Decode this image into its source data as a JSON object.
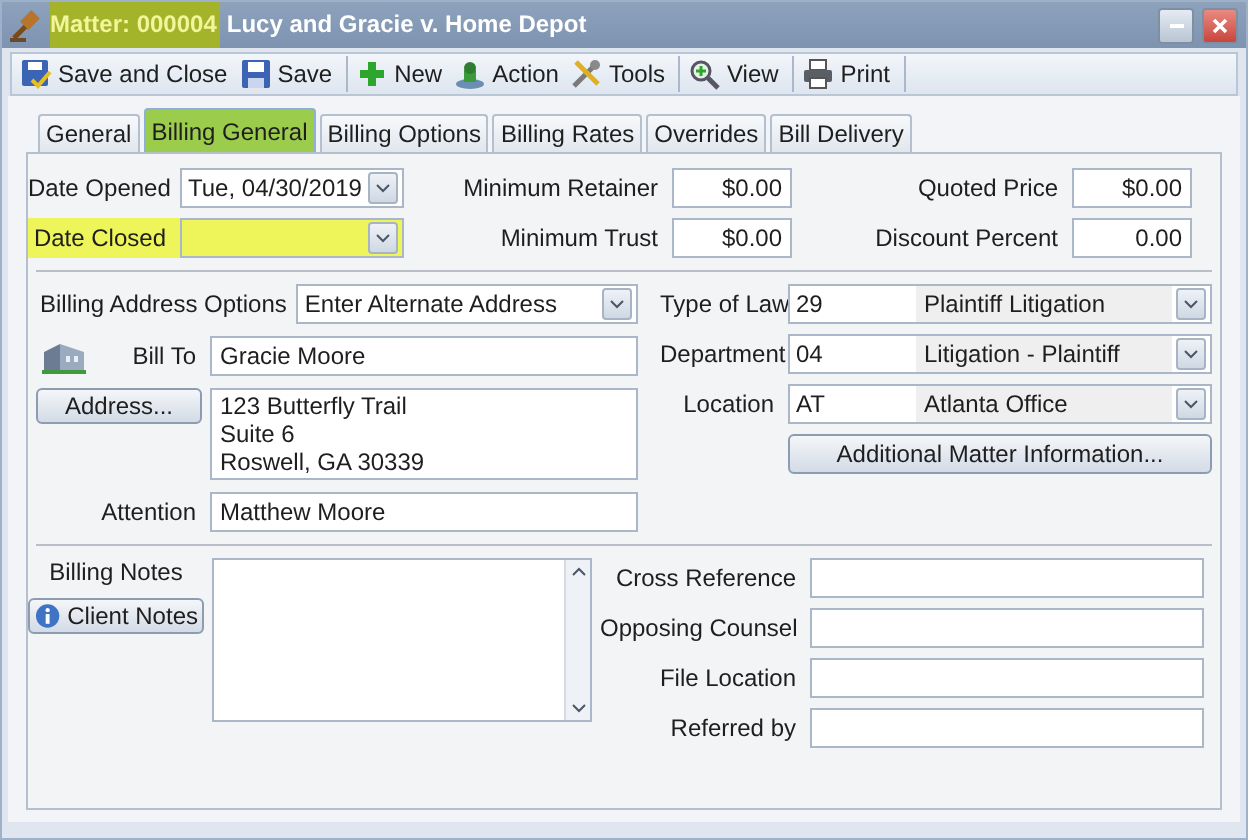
{
  "window": {
    "title_prefix": "Matter: 000004",
    "title_highlighted": true,
    "title": "Lucy and Gracie v. Home Depot"
  },
  "toolbar": [
    [
      {
        "kind": "save-close",
        "label": "Save and Close"
      },
      {
        "kind": "save",
        "label": "Save"
      }
    ],
    [
      {
        "kind": "new",
        "label": "New"
      },
      {
        "kind": "action",
        "label": "Action"
      },
      {
        "kind": "tools",
        "label": "Tools"
      }
    ],
    [
      {
        "kind": "view",
        "label": "View"
      }
    ],
    [
      {
        "kind": "print",
        "label": "Print"
      }
    ]
  ],
  "tabs": [
    {
      "label": "General",
      "selected": false,
      "highlighted": false
    },
    {
      "label": "Billing General",
      "selected": true,
      "highlighted": true
    },
    {
      "label": "Billing Options",
      "selected": false,
      "highlighted": false
    },
    {
      "label": "Billing Rates",
      "selected": false,
      "highlighted": false
    },
    {
      "label": "Overrides",
      "selected": false,
      "highlighted": false
    },
    {
      "label": "Bill Delivery",
      "selected": false,
      "highlighted": false
    }
  ],
  "dates": [
    {
      "label": "Date Opened",
      "value": "Tue, 04/30/2019",
      "highlighted": false
    },
    {
      "label": "Date Closed",
      "highlighted": true
    }
  ],
  "amounts": [
    {
      "label": "Minimum Retainer",
      "value": "$0.00"
    },
    {
      "label": "Quoted Price",
      "value": "$0.00"
    },
    {
      "label": "Minimum Trust",
      "value": "$0.00"
    },
    {
      "label": "Discount Percent",
      "value": "0.00"
    }
  ],
  "billing_address_options": {
    "label": "Billing Address Options",
    "value": "Enter Alternate Address"
  },
  "bill_to": {
    "label": "Bill To",
    "value": "Gracie Moore"
  },
  "address_button": "Address...",
  "address_lines": [
    "123 Butterfly Trail",
    "Suite 6",
    "Roswell, GA 30339"
  ],
  "attention": {
    "label": "Attention",
    "value": "Matthew Moore"
  },
  "classifications": [
    {
      "label": "Type of Law",
      "code": "29",
      "description": "Plaintiff Litigation"
    },
    {
      "label": "Department",
      "code": "04",
      "description": "Litigation - Plaintiff"
    },
    {
      "label": "Location",
      "code": "AT",
      "description": "Atlanta Office"
    }
  ],
  "additional_button": "Additional Matter Information...",
  "billing_notes_label": "Billing Notes",
  "client_notes_button": "Client Notes",
  "reference_fields": [
    {
      "label": "Cross Reference"
    },
    {
      "label": "Opposing Counsel"
    },
    {
      "label": "File Location"
    },
    {
      "label": "Referred by"
    }
  ]
}
